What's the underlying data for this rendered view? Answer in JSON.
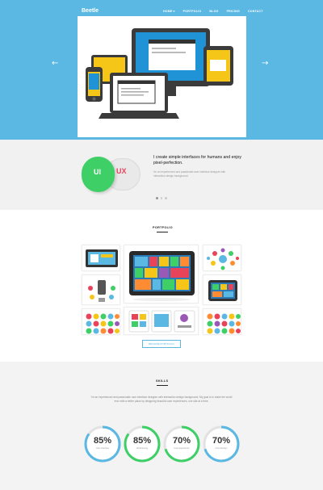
{
  "brand": {
    "logo": "Beetle",
    "accent": "#5ab8e2"
  },
  "nav": {
    "items": [
      {
        "label": "HOME"
      },
      {
        "label": "PORTFOLIO"
      },
      {
        "label": "BLOG"
      },
      {
        "label": "PRICING"
      },
      {
        "label": "CONTACT"
      }
    ],
    "chevron": "▾"
  },
  "hero": {
    "prev": "←",
    "next": "→"
  },
  "intro": {
    "ui_label": "UI",
    "ux_label": "UX",
    "title": "I create simple interfaces for humans and enjoy pixel-perfection.",
    "description": "I'm an experienced and passionate user interface designer with interaction design background.",
    "ui_color": "#3ecf67",
    "ux_color": "#e9435a"
  },
  "portfolio": {
    "title": "PORTFOLIO",
    "button": "BROWSE PORTFOLIO"
  },
  "skills": {
    "title": "SKILLS",
    "description": "I'm an experienced and passionate user interface designer with interaction design background. My goal is to make the world ever with a better place by designing beautiful user experiences, one site at a time.",
    "items": [
      {
        "value": "85%",
        "label": "User Interface",
        "level": 0.85,
        "color": "#5ab8e2"
      },
      {
        "value": "85%",
        "label": "Wireframing",
        "level": 0.85,
        "color": "#3ecf67"
      },
      {
        "value": "70%",
        "label": "User Experience",
        "level": 0.7,
        "color": "#3ecf67"
      },
      {
        "value": "70%",
        "label": "Front Design",
        "level": 0.7,
        "color": "#5ab8e2"
      }
    ]
  }
}
